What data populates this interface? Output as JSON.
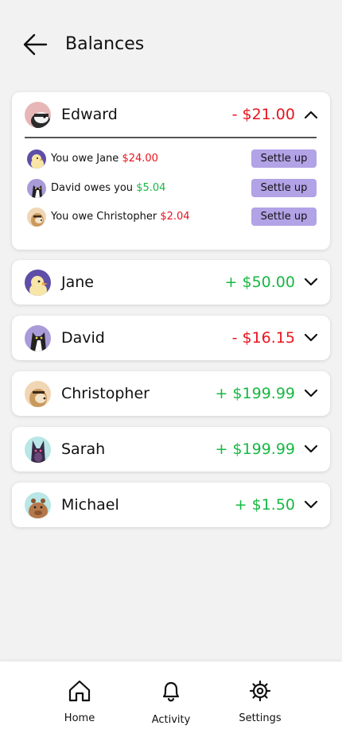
{
  "header": {
    "title": "Balances"
  },
  "expanded": {
    "name": "Edward",
    "amount": "- $21.00",
    "details": [
      {
        "prefix": "You owe Jane ",
        "amount": "$24.00",
        "button": "Settle up"
      },
      {
        "prefix": "David owes you ",
        "amount": "$5.04",
        "button": "Settle up"
      },
      {
        "prefix": "You owe Christopher ",
        "amount": "$2.04",
        "button": "Settle up"
      }
    ]
  },
  "balances": [
    {
      "name": "Jane",
      "amount": "+ $50.00"
    },
    {
      "name": "David",
      "amount": "- $16.15"
    },
    {
      "name": "Christopher",
      "amount": "+ $199.99"
    },
    {
      "name": "Sarah",
      "amount": "+ $199.99"
    },
    {
      "name": "Michael",
      "amount": "+ $1.50"
    }
  ],
  "nav": {
    "home": "Home",
    "activity": "Activity",
    "settings": "Settings"
  },
  "colors": {
    "negative": "#e8141e",
    "positive": "#17b843",
    "settle_button": "#b2a2e6"
  },
  "icons": {
    "back": "arrow-left-icon",
    "expand": "chevron-down-icon",
    "collapse": "chevron-up-icon",
    "home": "home-icon",
    "activity": "bell-icon",
    "settings": "gear-icon"
  }
}
